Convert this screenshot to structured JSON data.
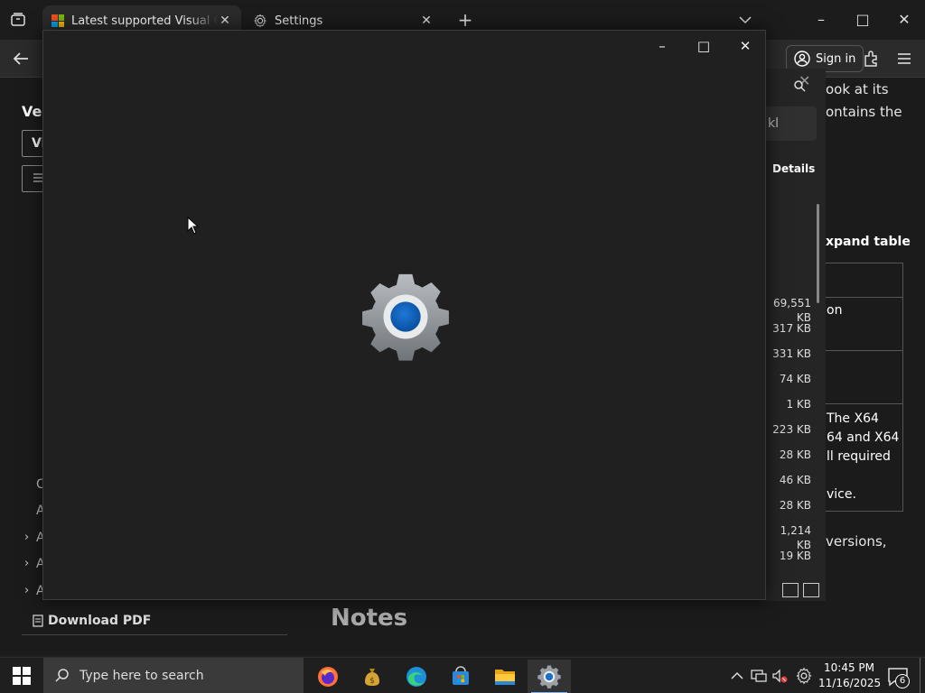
{
  "browser": {
    "tabs": [
      {
        "title": "Latest supported Visual C++ Re",
        "active": true
      },
      {
        "title": "Settings",
        "active": false
      }
    ],
    "new_tab": "+",
    "sign_in": "Sign in",
    "window_controls": {
      "minimize": "–",
      "maximize": "□",
      "close": "✕"
    }
  },
  "page": {
    "left_nav_title": "Ver",
    "left_box_1": "Vi",
    "nav_items": [
      "C",
      "A",
      "A",
      "A",
      "A"
    ],
    "download_pdf": "Download PDF",
    "notes_heading": "Notes",
    "right_text": [
      "ook at its",
      "ontains the",
      "versions,"
    ],
    "expand_table": "xpand table",
    "right_table_rows": [
      "",
      "on",
      "",
      "The X64\n64 and X64\nll required\n\nvice."
    ]
  },
  "side_panel": {
    "search_text": "kl",
    "details_label": "Details",
    "sizes": [
      "69,551 KB",
      "317 KB",
      "331 KB",
      "74 KB",
      "1 KB",
      "223 KB",
      "28 KB",
      "46 KB",
      "28 KB",
      "1,214 KB",
      "19 KB"
    ]
  },
  "dialog": {
    "icon": "settings-gear-icon"
  },
  "taskbar": {
    "search_placeholder": "Type here to search",
    "time": "10:45 PM",
    "date": "11/16/2025",
    "notification_count": "6",
    "apps": [
      "firefox-icon",
      "money-bag-icon",
      "edge-icon",
      "store-icon",
      "file-explorer-icon",
      "settings-icon"
    ]
  }
}
